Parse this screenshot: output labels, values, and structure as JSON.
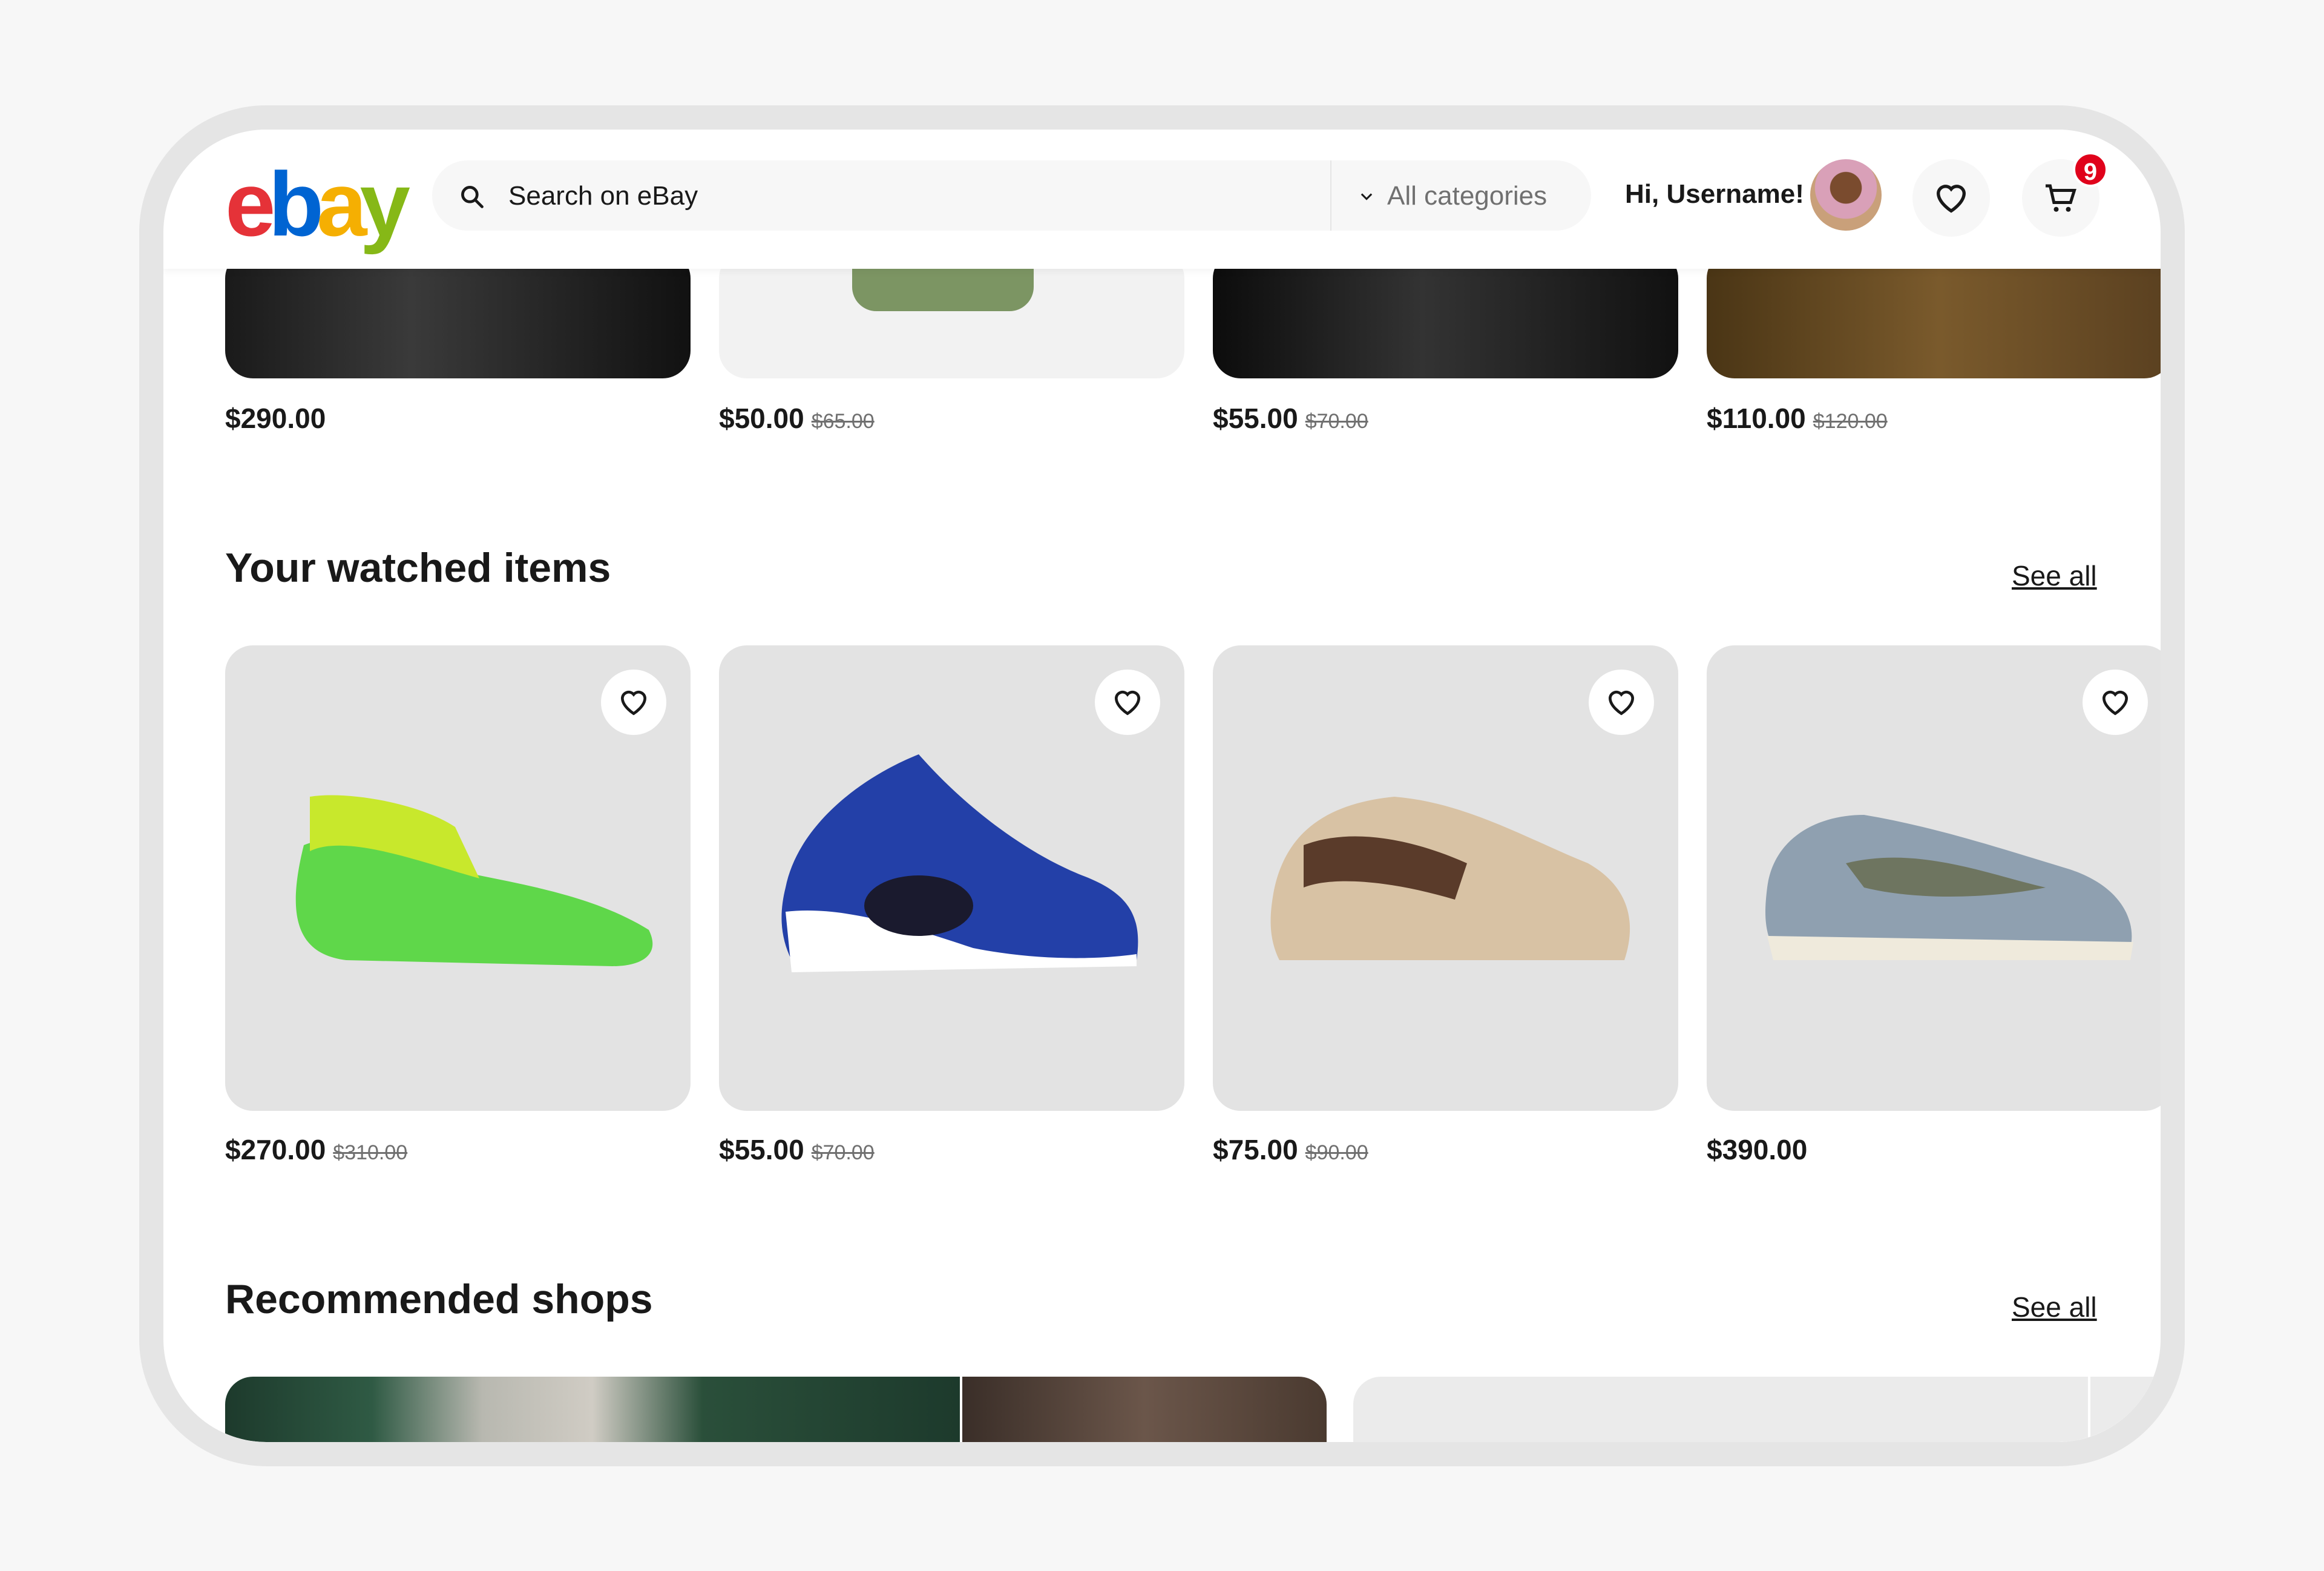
{
  "header": {
    "logo": "ebay",
    "search_placeholder": "Search on eBay",
    "category": "All categories",
    "greeting": "Hi, Username!",
    "cart_count": "9"
  },
  "colors": {
    "logo": [
      "#e53238",
      "#0064d2",
      "#f5af02",
      "#86b817"
    ],
    "badge": "#e0021b"
  },
  "recent_items": [
    {
      "price": "$290.00",
      "old": ""
    },
    {
      "price": "$50.00",
      "old": "$65.00"
    },
    {
      "price": "$55.00",
      "old": "$70.00"
    },
    {
      "price": "$110.00",
      "old": "$120.00"
    }
  ],
  "watched": {
    "title": "Your watched items",
    "see_all": "See all",
    "items": [
      {
        "price": "$270.00",
        "old": "$310.00"
      },
      {
        "price": "$55.00",
        "old": "$70.00"
      },
      {
        "price": "$75.00",
        "old": "$90.00"
      },
      {
        "price": "$390.00",
        "old": ""
      }
    ]
  },
  "shops": {
    "title": "Recommended shops",
    "see_all": "See all"
  }
}
